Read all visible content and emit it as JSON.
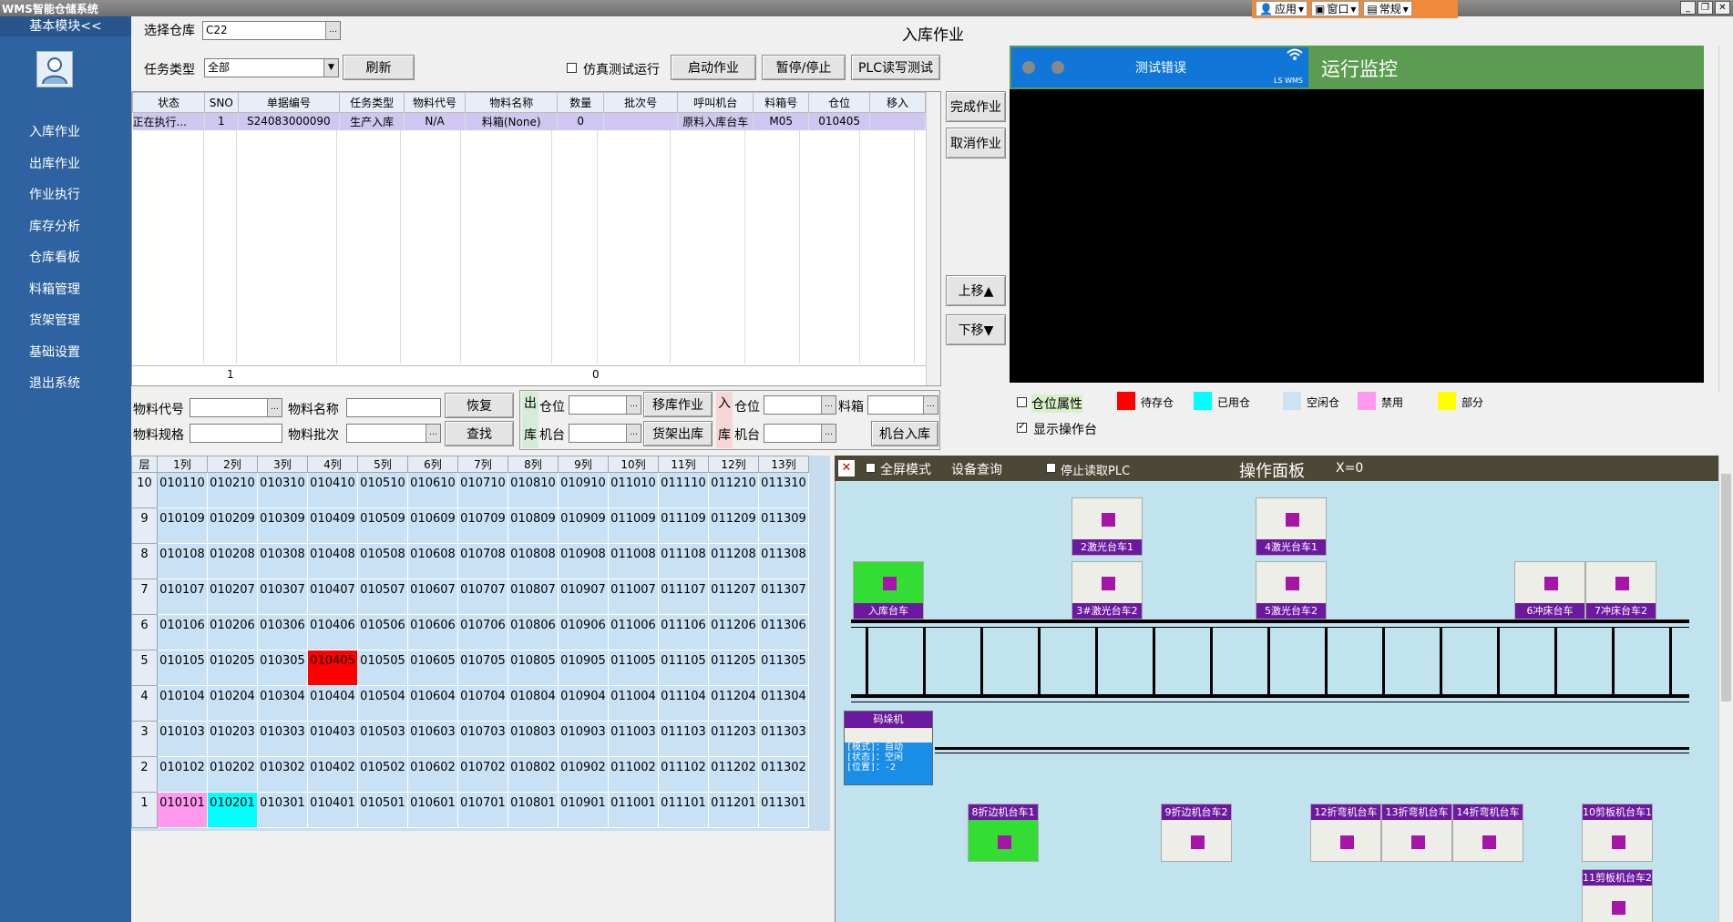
{
  "titlebar": {
    "title": "WMS智能仓储系统"
  },
  "topmenu": [
    {
      "label": "应用",
      "icon": "app-icon"
    },
    {
      "label": "窗口",
      "icon": "window-icon"
    },
    {
      "label": "常规",
      "icon": "normal-icon"
    }
  ],
  "sidebar": {
    "header": "基本模块<<",
    "items": [
      "入库作业",
      "出库作业",
      "作业执行",
      "库存分析",
      "仓库看板",
      "料箱管理",
      "货架管理",
      "基础设置",
      "退出系统"
    ]
  },
  "page": {
    "title": "入库作业"
  },
  "warehouse": {
    "label": "选择仓库",
    "value": "C22"
  },
  "taskType": {
    "label": "任务类型",
    "value": "全部"
  },
  "buttons": {
    "refresh": "刷新",
    "simulate": "仿真测试运行",
    "start": "启动作业",
    "pause": "暂停/停止",
    "plc": "PLC读写测试",
    "complete": "完成作业",
    "cancel": "取消作业",
    "up": "上移▲",
    "down": "下移▼",
    "restore": "恢复",
    "search": "查找",
    "moveStock": "移库作业",
    "shelfOut": "货架出库",
    "machineIn": "机台入库"
  },
  "taskTable": {
    "columns": [
      "状态",
      "SNO",
      "单据编号",
      "任务类型",
      "物料代号",
      "物料名称",
      "数量",
      "批次号",
      "呼叫机台",
      "料箱号",
      "仓位",
      "移入"
    ],
    "rows": [
      [
        "正在执行...",
        "1",
        "S24083000090",
        "生产入库",
        "N/A",
        "料箱(None)",
        "0",
        "",
        "原料入库台车",
        "M05",
        "010405",
        ""
      ]
    ],
    "footer": {
      "sno": "1",
      "qty": "0"
    }
  },
  "filters": {
    "materialCode": "物料代号",
    "materialName": "物料名称",
    "materialSpec": "物料规格",
    "materialBatch": "物料批次",
    "outLabel": "出",
    "inLabel": "入",
    "ku": "库",
    "slot": "仓位",
    "machine": "机台",
    "box": "料箱"
  },
  "monitor": {
    "error": "测试错误",
    "brand": "LS WMS",
    "title": "运行监控"
  },
  "legend": {
    "slotAttr": "仓位属性",
    "items": [
      {
        "label": "待存仓",
        "color": "#ff0000"
      },
      {
        "label": "已用仓",
        "color": "#00ffff"
      },
      {
        "label": "空闲仓",
        "color": "#cde3f4"
      },
      {
        "label": "禁用",
        "color": "#ff99ee"
      },
      {
        "label": "部分",
        "color": "#ffff00"
      }
    ],
    "showStation": "显示操作台"
  },
  "slotGrid": {
    "layerHeader": "层",
    "columns": [
      "1列",
      "2列",
      "3列",
      "4列",
      "5列",
      "6列",
      "7列",
      "8列",
      "9列",
      "10列",
      "11列",
      "12列",
      "13列"
    ],
    "layers": [
      "10",
      "9",
      "8",
      "7",
      "6",
      "5",
      "4",
      "3",
      "2",
      "1"
    ],
    "highlights": {
      "010405": "#ff0000",
      "010101": "#ff99ee",
      "010201": "#00ffff"
    }
  },
  "opPanel": {
    "fullscreen": "全屏模式",
    "deviceQuery": "设备查询",
    "stopPlc": "停止读取PLC",
    "title": "操作面板",
    "x": "X=0",
    "stacker": {
      "name": "码垛机",
      "lines": [
        "[模式]：自动",
        "[状态]：空闲",
        "[位置]：-2"
      ]
    },
    "stations": [
      "2激光台车1",
      "4激光台车1",
      "入库台车",
      "3#激光台车2",
      "5激光台车2",
      "6冲床台车",
      "7冲床台车2",
      "8折边机台车1",
      "9折边机台车2",
      "12折弯机台车",
      "13折弯机台车",
      "14折弯机台车",
      "10剪板机台车1",
      "11剪板机台车2"
    ]
  }
}
